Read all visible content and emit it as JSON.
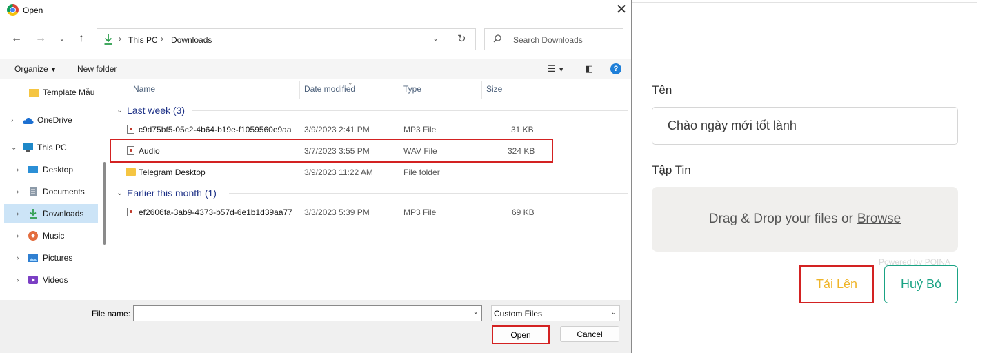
{
  "dialog": {
    "title": "Open",
    "address": {
      "segments": [
        "This PC",
        "Downloads"
      ]
    },
    "search_placeholder": "Search Downloads",
    "toolbar": {
      "organize": "Organize",
      "new_folder": "New folder"
    },
    "nav_items": [
      {
        "label": "Template Mẫu",
        "icon": "folder-icon"
      },
      {
        "label": "OneDrive",
        "icon": "cloud-icon"
      },
      {
        "label": "This PC",
        "icon": "computer-icon"
      },
      {
        "label": "Desktop",
        "icon": "desktop-icon"
      },
      {
        "label": "Documents",
        "icon": "documents-icon"
      },
      {
        "label": "Downloads",
        "icon": "download-icon",
        "selected": true
      },
      {
        "label": "Music",
        "icon": "music-icon"
      },
      {
        "label": "Pictures",
        "icon": "pictures-icon"
      },
      {
        "label": "Videos",
        "icon": "videos-icon"
      }
    ],
    "columns": [
      "Name",
      "Date modified",
      "Type",
      "Size"
    ],
    "groups": [
      {
        "label": "Last week (3)",
        "files": [
          {
            "name": "c9d75bf5-05c2-4b64-b19e-f1059560e9aa",
            "date": "3/9/2023 2:41 PM",
            "type": "MP3 File",
            "size": "31 KB"
          },
          {
            "name": "Audio",
            "date": "3/7/2023 3:55 PM",
            "type": "WAV File",
            "size": "324 KB"
          },
          {
            "name": "Telegram Desktop",
            "date": "3/9/2023 11:22 AM",
            "type": "File folder",
            "size": ""
          }
        ]
      },
      {
        "label": "Earlier this month (1)",
        "files": [
          {
            "name": "ef2606fa-3ab9-4373-b57d-6e1b1d39aa77",
            "date": "3/3/2023 5:39 PM",
            "type": "MP3 File",
            "size": "69 KB"
          }
        ]
      }
    ],
    "file_name_label": "File name:",
    "file_name_value": "",
    "file_type": "Custom Files",
    "open_button": "Open",
    "cancel_button": "Cancel"
  },
  "page": {
    "name_label": "Tên",
    "name_value": "Chào ngày mới tốt lành",
    "file_label": "Tập Tin",
    "dropzone_text": "Drag & Drop your files or",
    "dropzone_browse": "Browse",
    "powered_by": "Powered by PQINA",
    "upload_button": "Tải Lên",
    "cancel_button": "Huỷ Bỏ",
    "colors": {
      "upload_text": "#efb52a",
      "cancel_accent": "#1aa384",
      "highlight": "#d32222"
    }
  }
}
